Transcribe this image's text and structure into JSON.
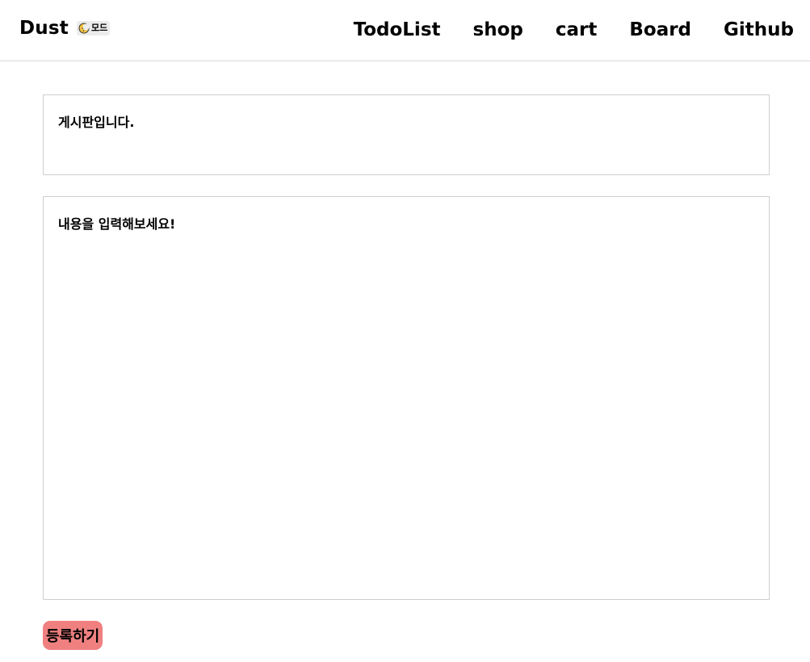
{
  "header": {
    "brand": "Dust",
    "mode_toggle": {
      "icon": "moon-icon",
      "label": "모드"
    },
    "nav": [
      {
        "label": "TodoList"
      },
      {
        "label": "shop"
      },
      {
        "label": "cart"
      },
      {
        "label": "Board"
      },
      {
        "label": "Github"
      }
    ]
  },
  "form": {
    "title_placeholder": "게시판입니다.",
    "content_placeholder": "내용을 입력해보세요!",
    "submit_label": "등록하기"
  },
  "colors": {
    "submit_button": "#f08080",
    "border": "#cfcfcf",
    "mode_icon": "#f5c542"
  }
}
